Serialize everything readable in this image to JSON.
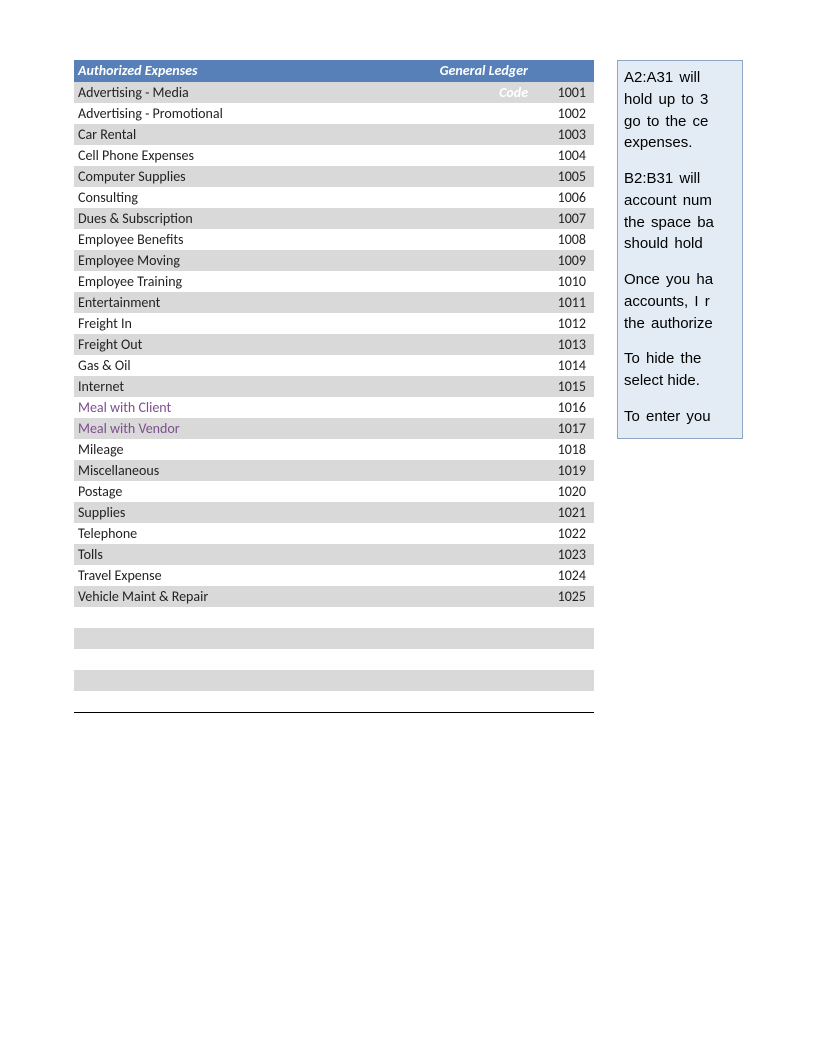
{
  "table": {
    "headers": {
      "expenses": "Authorized Expenses",
      "code": "General Ledger Code"
    },
    "rows": [
      {
        "name": "Advertising - Media",
        "code": "1001",
        "purple": false
      },
      {
        "name": "Advertising - Promotional",
        "code": "1002",
        "purple": false
      },
      {
        "name": "Car Rental",
        "code": "1003",
        "purple": false
      },
      {
        "name": "Cell Phone Expenses",
        "code": "1004",
        "purple": false
      },
      {
        "name": "Computer Supplies",
        "code": "1005",
        "purple": false
      },
      {
        "name": "Consulting",
        "code": "1006",
        "purple": false
      },
      {
        "name": "Dues & Subscription",
        "code": "1007",
        "purple": false
      },
      {
        "name": "Employee Benefits",
        "code": "1008",
        "purple": false
      },
      {
        "name": "Employee Moving",
        "code": "1009",
        "purple": false
      },
      {
        "name": "Employee Training",
        "code": "1010",
        "purple": false
      },
      {
        "name": "Entertainment",
        "code": "1011",
        "purple": false
      },
      {
        "name": "Freight In",
        "code": "1012",
        "purple": false
      },
      {
        "name": "Freight Out",
        "code": "1013",
        "purple": false
      },
      {
        "name": "Gas & Oil",
        "code": "1014",
        "purple": false
      },
      {
        "name": "Internet",
        "code": "1015",
        "purple": false
      },
      {
        "name": "Meal with Client",
        "code": "1016",
        "purple": true
      },
      {
        "name": "Meal with Vendor",
        "code": "1017",
        "purple": true
      },
      {
        "name": "Mileage",
        "code": "1018",
        "purple": false
      },
      {
        "name": "Miscellaneous",
        "code": "1019",
        "purple": false
      },
      {
        "name": "Postage",
        "code": "1020",
        "purple": false
      },
      {
        "name": "Supplies",
        "code": "1021",
        "purple": false
      },
      {
        "name": "Telephone",
        "code": "1022",
        "purple": false
      },
      {
        "name": "Tolls",
        "code": "1023",
        "purple": false
      },
      {
        "name": "Travel Expense",
        "code": "1024",
        "purple": false
      },
      {
        "name": "Vehicle Maint & Repair",
        "code": "1025",
        "purple": false
      },
      {
        "name": "",
        "code": "",
        "purple": false
      },
      {
        "name": "",
        "code": "",
        "purple": false
      },
      {
        "name": "",
        "code": "",
        "purple": false
      },
      {
        "name": "",
        "code": "",
        "purple": false
      },
      {
        "name": "",
        "code": "",
        "purple": false
      }
    ]
  },
  "note": {
    "p1a": "A2:A31 will ",
    "p1b": "hold up to 3",
    "p1c": "go to the ce",
    "p1d": "expenses.",
    "p2a": "B2:B31 will ",
    "p2b": "account num",
    "p2c": "the space ba",
    "p2d": "should hold ",
    "p3a": "Once you ha",
    "p3b": "accounts, I r",
    "p3c": "the authorize",
    "p4a": "To hide the ",
    "p4b": "select hide.",
    "p5a": "To enter you"
  }
}
